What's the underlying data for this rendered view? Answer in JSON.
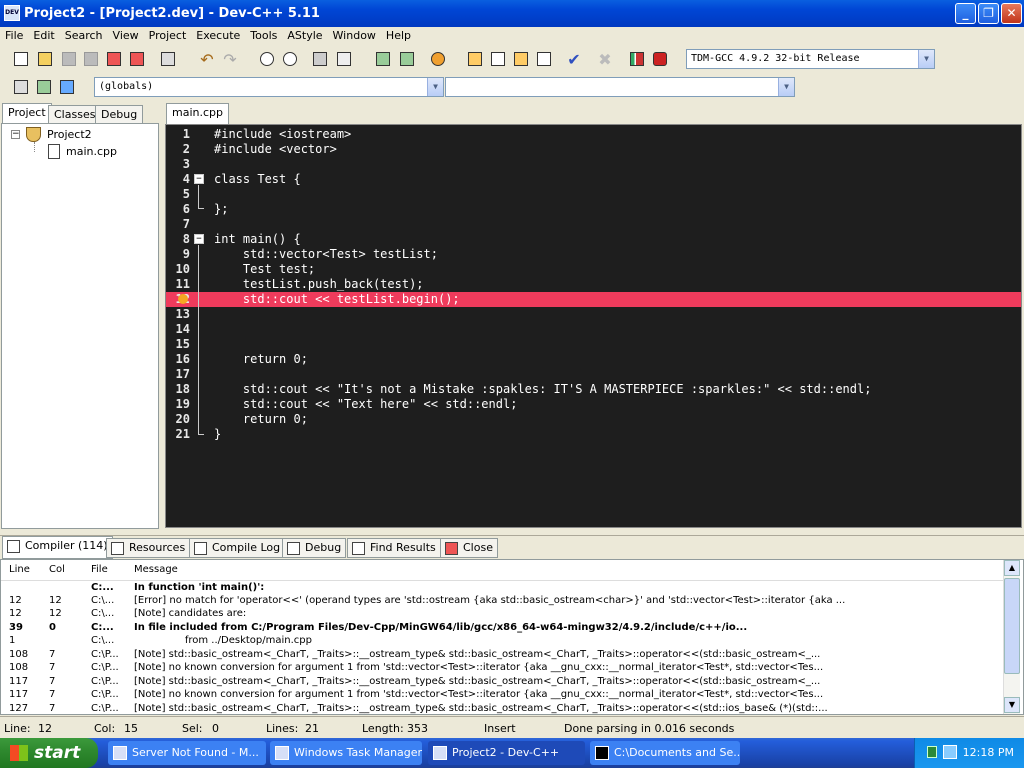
{
  "window": {
    "title": "Project2 - [Project2.dev] - Dev-C++ 5.11",
    "app_icon": "DEV"
  },
  "menu": [
    "File",
    "Edit",
    "Search",
    "View",
    "Project",
    "Execute",
    "Tools",
    "AStyle",
    "Window",
    "Help"
  ],
  "toolbar": {
    "compiler": "TDM-GCC 4.9.2 32-bit Release",
    "scope": "(globals)",
    "symbol": ""
  },
  "left_tabs": [
    "Project",
    "Classes",
    "Debug"
  ],
  "tree": {
    "project": "Project2",
    "file": "main.cpp"
  },
  "editor_tab": "main.cpp",
  "code": [
    {
      "n": "1",
      "t": "#include <iostream>"
    },
    {
      "n": "2",
      "t": "#include <vector>"
    },
    {
      "n": "3",
      "t": ""
    },
    {
      "n": "4",
      "t": "class Test {"
    },
    {
      "n": "5",
      "t": ""
    },
    {
      "n": "6",
      "t": "};"
    },
    {
      "n": "7",
      "t": ""
    },
    {
      "n": "8",
      "t": "int main() {"
    },
    {
      "n": "9",
      "t": "    std::vector<Test> testList;"
    },
    {
      "n": "10",
      "t": "    Test test;"
    },
    {
      "n": "11",
      "t": "    testList.push_back(test);"
    },
    {
      "n": "12",
      "t": "    std::cout << testList.begin();"
    },
    {
      "n": "13",
      "t": ""
    },
    {
      "n": "14",
      "t": ""
    },
    {
      "n": "15",
      "t": ""
    },
    {
      "n": "16",
      "t": "    return 0;"
    },
    {
      "n": "17",
      "t": ""
    },
    {
      "n": "18",
      "t": "    std::cout << \"It's not a Mistake :spakles: IT'S A MASTERPIECE :sparkles:\" << std::endl;"
    },
    {
      "n": "19",
      "t": "    std::cout << \"Text here\" << std::endl;"
    },
    {
      "n": "20",
      "t": "    return 0;"
    },
    {
      "n": "21",
      "t": "}"
    }
  ],
  "bottom_tabs": [
    "Compiler (114)",
    "Resources",
    "Compile Log",
    "Debug",
    "Find Results",
    "Close"
  ],
  "results": {
    "headers": [
      "Line",
      "Col",
      "File",
      "Message"
    ],
    "rows": [
      {
        "line": "",
        "col": "",
        "file": "C:...",
        "msg": "In function 'int main()':",
        "bold": true
      },
      {
        "line": "12",
        "col": "12",
        "file": "C:\\...",
        "msg": "[Error] no match for 'operator<<' (operand types are 'std::ostream {aka std::basic_ostream<char>}' and 'std::vector<Test>::iterator {aka ...",
        "bold": false
      },
      {
        "line": "12",
        "col": "12",
        "file": "C:\\...",
        "msg": "[Note] candidates are:",
        "bold": false
      },
      {
        "line": "39",
        "col": "0",
        "file": "C:...",
        "msg": "In file included from C:/Program Files/Dev-Cpp/MinGW64/lib/gcc/x86_64-w64-mingw32/4.9.2/include/c++/io...",
        "bold": true
      },
      {
        "line": "1",
        "col": "",
        "file": "C:\\...",
        "msg": "                from ../Desktop/main.cpp",
        "bold": false
      },
      {
        "line": "108",
        "col": "7",
        "file": "C:\\P...",
        "msg": "[Note] std::basic_ostream<_CharT, _Traits>::__ostream_type& std::basic_ostream<_CharT, _Traits>::operator<<(std::basic_ostream<_...",
        "bold": false
      },
      {
        "line": "108",
        "col": "7",
        "file": "C:\\P...",
        "msg": "[Note] no known conversion for argument 1 from 'std::vector<Test>::iterator {aka __gnu_cxx::__normal_iterator<Test*, std::vector<Tes...",
        "bold": false
      },
      {
        "line": "117",
        "col": "7",
        "file": "C:\\P...",
        "msg": "[Note] std::basic_ostream<_CharT, _Traits>::__ostream_type& std::basic_ostream<_CharT, _Traits>::operator<<(std::basic_ostream<_...",
        "bold": false
      },
      {
        "line": "117",
        "col": "7",
        "file": "C:\\P...",
        "msg": "[Note] no known conversion for argument 1 from 'std::vector<Test>::iterator {aka __gnu_cxx::__normal_iterator<Test*, std::vector<Tes...",
        "bold": false
      },
      {
        "line": "127",
        "col": "7",
        "file": "C:\\P...",
        "msg": "[Note] std::basic_ostream<_CharT, _Traits>::__ostream_type& std::basic_ostream<_CharT, _Traits>::operator<<(std::ios_base& (*)(std::...",
        "bold": false
      }
    ]
  },
  "status": {
    "line_label": "Line:",
    "line": "12",
    "col_label": "Col:",
    "col": "15",
    "sel_label": "Sel:",
    "sel": "0",
    "lines_label": "Lines:",
    "lines": "21",
    "length_label": "Length:",
    "length": "353",
    "mode": "Insert",
    "parse": "Done parsing in 0.016 seconds"
  },
  "taskbar": {
    "start": "start",
    "tasks": [
      "Server Not Found - M...",
      "Windows Task Manager",
      "Project2 - Dev-C++",
      "C:\\Documents and Se..."
    ],
    "clock": "12:18 PM"
  },
  "colors": {
    "error_line": "#ef3b5c",
    "editor_bg": "#1e1e1e",
    "preprocessor": "#6e9cf0",
    "string": "#f0c020"
  }
}
